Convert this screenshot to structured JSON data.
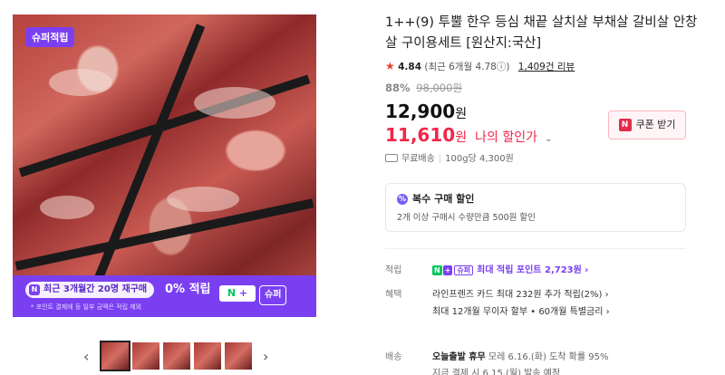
{
  "gallery": {
    "super_badge": "슈퍼적립",
    "promo": {
      "pill_icon": "N",
      "pill_text": "최근 3개월간 20명 재구매",
      "percent_text": "0% 적립",
      "note": "* 포인트 결제에 등 일부 금액은 적립 제외",
      "np_n": "N",
      "np_plus": "+",
      "super_tag": "슈퍼"
    },
    "arrow_left": "‹",
    "arrow_right": "›",
    "thumbnail_count": 5
  },
  "product": {
    "title": "1++(9) 투뿔 한우 등심 채끝 살치살 부채살 갈비살 안창살 구이용세트 [원산지:국산]",
    "rating": "4.84",
    "rating_recent": "(최근 6개월 4.78ⓘ)",
    "reviews_label": "1,409건 리뷰",
    "discount_pct": "88%",
    "original_price": "98,000원",
    "price": "12,900",
    "price_unit": "원",
    "my_price": "11,610",
    "my_price_unit": "원",
    "my_price_label": "나의 할인가",
    "coupon_button": "쿠폰 받기",
    "coupon_icon": "N",
    "shipping_free": "무료배송",
    "shipping_unit": "100g당 4,300원"
  },
  "multi_discount": {
    "icon": "%",
    "title": "복수 구매 할인",
    "desc": "2개 이상 구매시 수량만큼 500원 할인"
  },
  "specs": {
    "points_label": "적립",
    "points_n": "N",
    "points_plus": "+",
    "points_super": "슈퍼",
    "points_text": "최대 적립 포인트 2,723원 ›",
    "benefit_label": "혜택",
    "benefit_line1": "라인프렌즈 카드 최대 232원 추가 적립(2%) ›",
    "benefit_line2": "최대 12개월 무이자 할부 • 60개월 특별금리 ›",
    "delivery_label": "배송",
    "delivery_bold": "오늘출발 휴무",
    "delivery_text": "모레 6.16.(화) 도착 확률 95%",
    "delivery_line2": "지금 결제 시 6.15.(월) 발송 예정"
  },
  "colors": {
    "accent": "#7b3ff2",
    "price_red": "#f0264a",
    "naver_green": "#03c75a"
  }
}
